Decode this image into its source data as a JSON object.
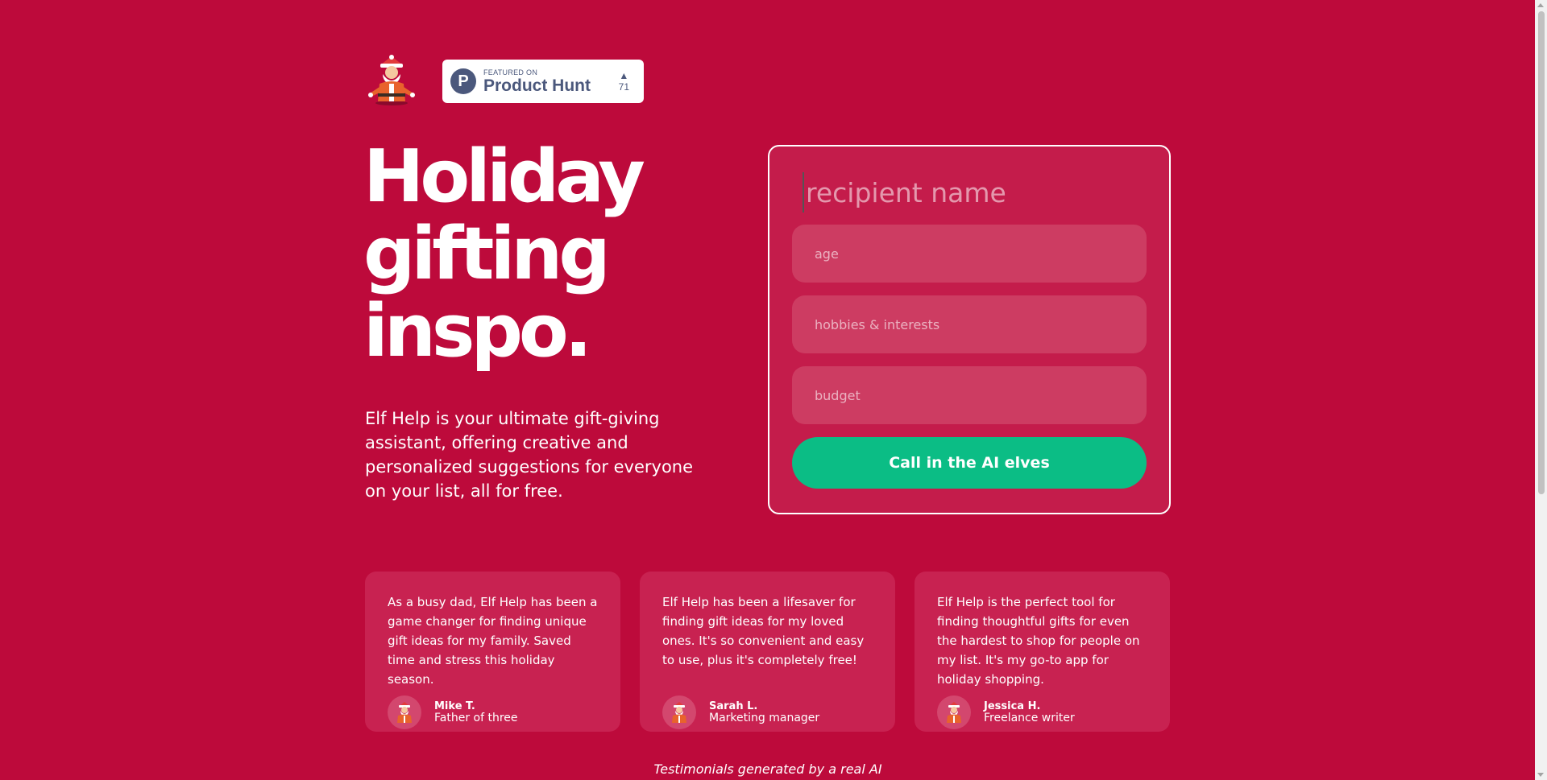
{
  "colors": {
    "background": "#bd0a3b",
    "card": "#c82251",
    "field": "#cd3c62",
    "accent_button": "#0bbd85",
    "product_hunt": "#4b587c"
  },
  "header": {
    "logo_icon": "elf-santa-logo-icon",
    "product_hunt": {
      "featured_label": "FEATURED ON",
      "name": "Product Hunt",
      "logo_letter": "P",
      "arrow": "▲",
      "votes": "71"
    }
  },
  "hero": {
    "title": "Holiday gifting inspo.",
    "description": "Elf Help is your ultimate gift-giving assistant, offering creative and personalized suggestions for everyone on your list, all for free."
  },
  "form": {
    "recipient_placeholder": "recipient name",
    "age_placeholder": "age",
    "hobbies_placeholder": "hobbies & interests",
    "budget_placeholder": "budget",
    "submit_label": "Call in the AI elves"
  },
  "testimonials": [
    {
      "quote": "As a busy dad, Elf Help has been a game changer for finding unique gift ideas for my family. Saved time and stress this holiday season.",
      "name": "Mike T.",
      "role": "Father of three",
      "avatar_icon": "elf-avatar-icon"
    },
    {
      "quote": "Elf Help has been a lifesaver for finding gift ideas for my loved ones. It's so convenient and easy to use, plus it's completely free!",
      "name": "Sarah L.",
      "role": "Marketing manager",
      "avatar_icon": "elf-avatar-icon"
    },
    {
      "quote": "Elf Help is the perfect tool for finding thoughtful gifts for even the hardest to shop for people on my list. It's my go-to app for holiday shopping.",
      "name": "Jessica H.",
      "role": "Freelance writer",
      "avatar_icon": "elf-avatar-icon"
    }
  ],
  "footnote": "Testimonials generated by a real AI"
}
